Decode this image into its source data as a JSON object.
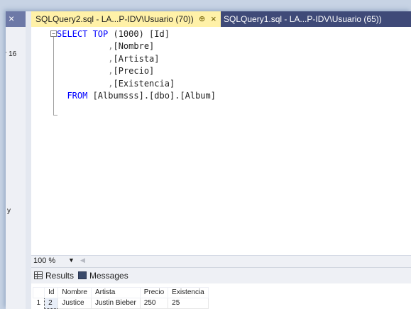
{
  "left_panel": {
    "close_glyph": "×",
    "snippet_1": "r 16",
    "snippet_2": "y"
  },
  "tabs": {
    "active": {
      "title": "SQLQuery2.sql - LA...P-IDV\\Usuario (70))",
      "pin": "⊕",
      "close": "×"
    },
    "inactive": {
      "title": "SQLQuery1.sql - LA...P-IDV\\Usuario (65))"
    }
  },
  "editor": {
    "collapse_glyph": "−",
    "lines": [
      {
        "kw": "SELECT TOP",
        "num": " (1000)",
        "rest": " [Id]"
      },
      {
        "comma": ",",
        "col": "[Nombre]"
      },
      {
        "comma": ",",
        "col": "[Artista]"
      },
      {
        "comma": ",",
        "col": "[Precio]"
      },
      {
        "comma": ",",
        "col": "[Existencia]"
      },
      {
        "kw": "FROM",
        "rest": " [Albumsss].[dbo].[Album]"
      }
    ]
  },
  "zoom": {
    "value": "100 %",
    "arrow": "▼",
    "scroll_glyph": "◀"
  },
  "result_tabs": {
    "results": "Results",
    "messages": "Messages"
  },
  "results_grid": {
    "columns": [
      "Id",
      "Nombre",
      "Artista",
      "Precio",
      "Existencia"
    ],
    "rows": [
      {
        "num": "1",
        "cells": [
          "2",
          "Justice",
          "Justin Bieber",
          "250",
          "25"
        ]
      }
    ]
  }
}
